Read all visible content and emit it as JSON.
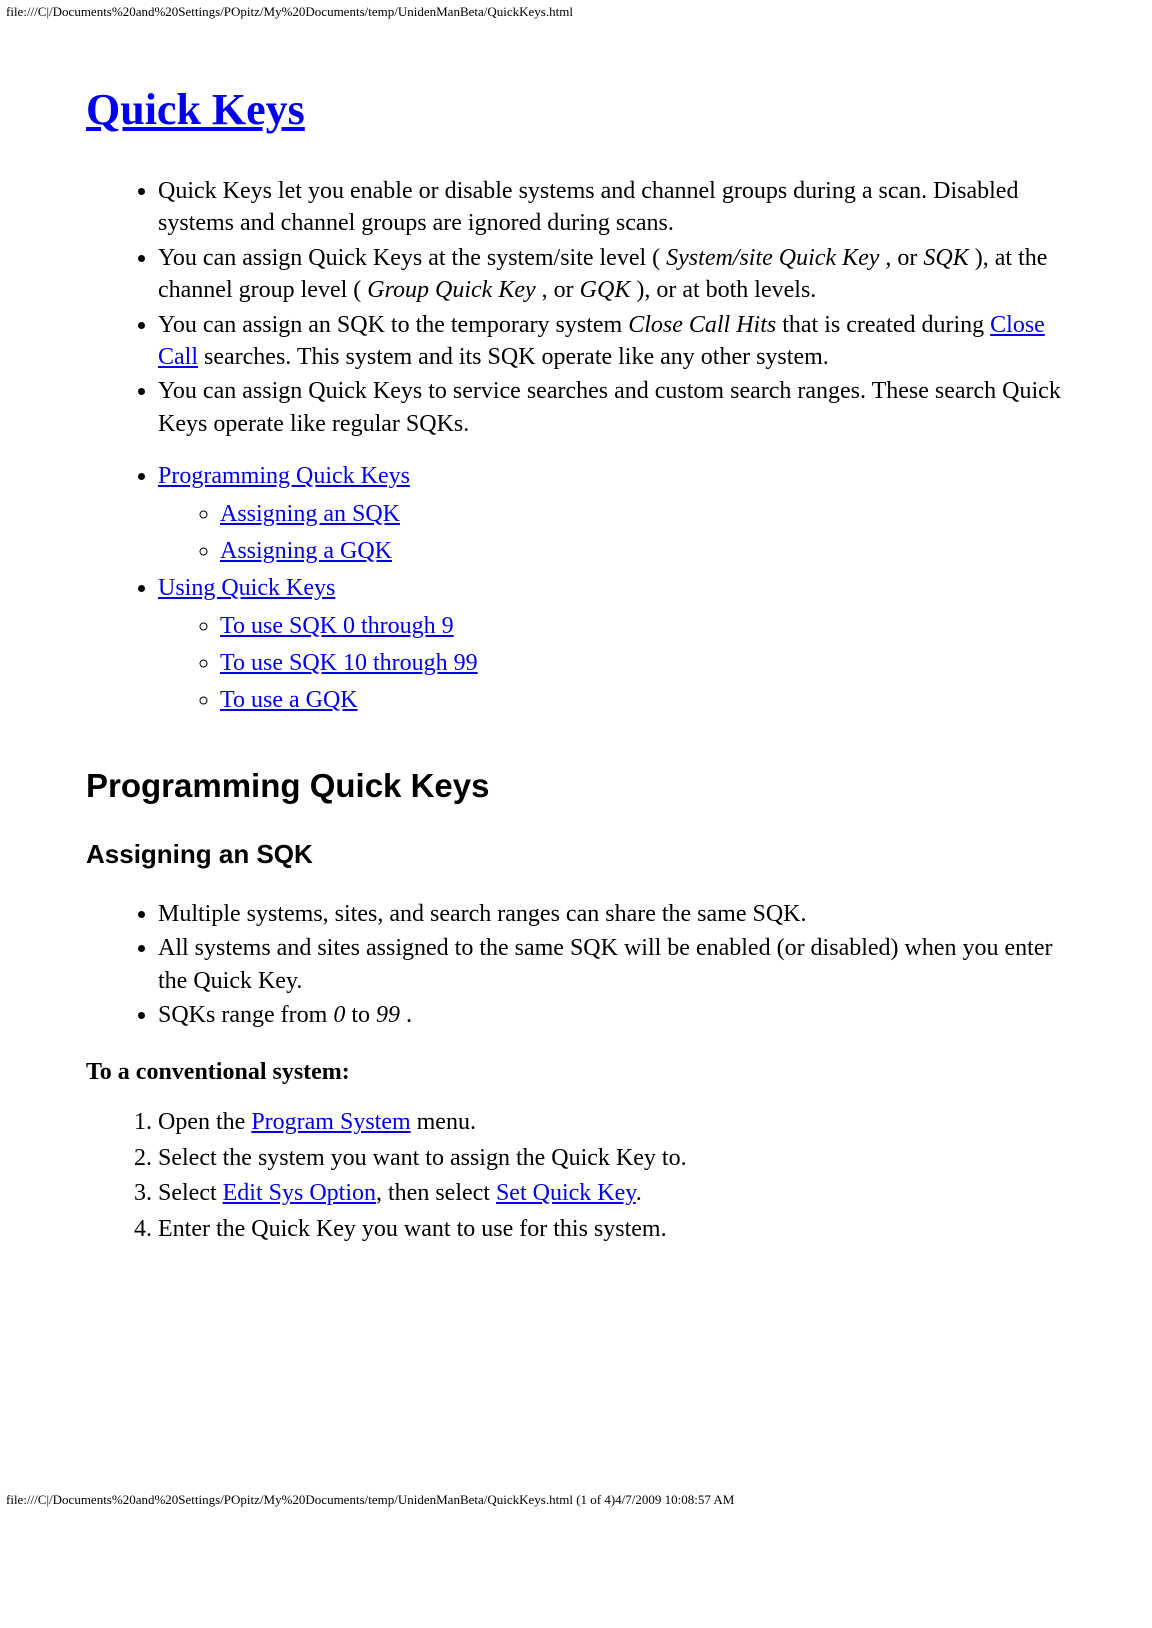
{
  "header_path": "file:///C|/Documents%20and%20Settings/POpitz/My%20Documents/temp/UnidenManBeta/QuickKeys.html",
  "footer_path": "file:///C|/Documents%20and%20Settings/POpitz/My%20Documents/temp/UnidenManBeta/QuickKeys.html (1 of 4)4/7/2009 10:08:57 AM",
  "title": "Quick Keys",
  "intro": {
    "li1": "Quick Keys let you enable or disable systems and channel groups during a scan. Disabled systems and channel groups are ignored during scans.",
    "li2_a": "You can assign Quick Keys at the system/site level ( ",
    "li2_b": "System/site Quick Key",
    "li2_c": " , or ",
    "li2_d": "SQK",
    "li2_e": " ), at the channel group level ( ",
    "li2_f": "Group Quick Key",
    "li2_g": " , or ",
    "li2_h": "GQK",
    "li2_i": " ), or at both levels.",
    "li3_a": "You can assign an SQK to the temporary system ",
    "li3_b": "Close Call Hits",
    "li3_c": " that is created during ",
    "li3_link": "Close Call",
    "li3_d": " searches. This system and its SQK operate like any other system.",
    "li4": "You can assign Quick Keys to service searches and custom search ranges. These search Quick Keys operate like regular SQKs."
  },
  "toc": {
    "l1": "Programming Quick Keys",
    "l1a": "Assigning an SQK",
    "l1b": "Assigning a GQK",
    "l2": "Using Quick Keys",
    "l2a": "To use SQK 0 through 9",
    "l2b": "To use SQK 10 through 99",
    "l2c": "To use a GQK"
  },
  "h2_prog": "Programming Quick Keys",
  "h3_sqk": "Assigning an SQK",
  "sqk_bullets": {
    "b1": "Multiple systems, sites, and search ranges can share the same SQK.",
    "b2": "All systems and sites assigned to the same SQK will be enabled (or disabled) when you enter the Quick Key.",
    "b3_a": "SQKs range from ",
    "b3_b": "0",
    "b3_c": " to ",
    "b3_d": "99",
    "b3_e": " ."
  },
  "h4_conv": "To a conventional system:",
  "steps": {
    "s1_a": "Open the ",
    "s1_link": "Program System",
    "s1_b": " menu.",
    "s2": "Select the system you want to assign the Quick Key to.",
    "s3_a": "Select ",
    "s3_link1": "Edit Sys Option",
    "s3_b": ", then select ",
    "s3_link2": "Set Quick Key",
    "s3_c": ".",
    "s4": "Enter the Quick Key you want to use for this system."
  }
}
